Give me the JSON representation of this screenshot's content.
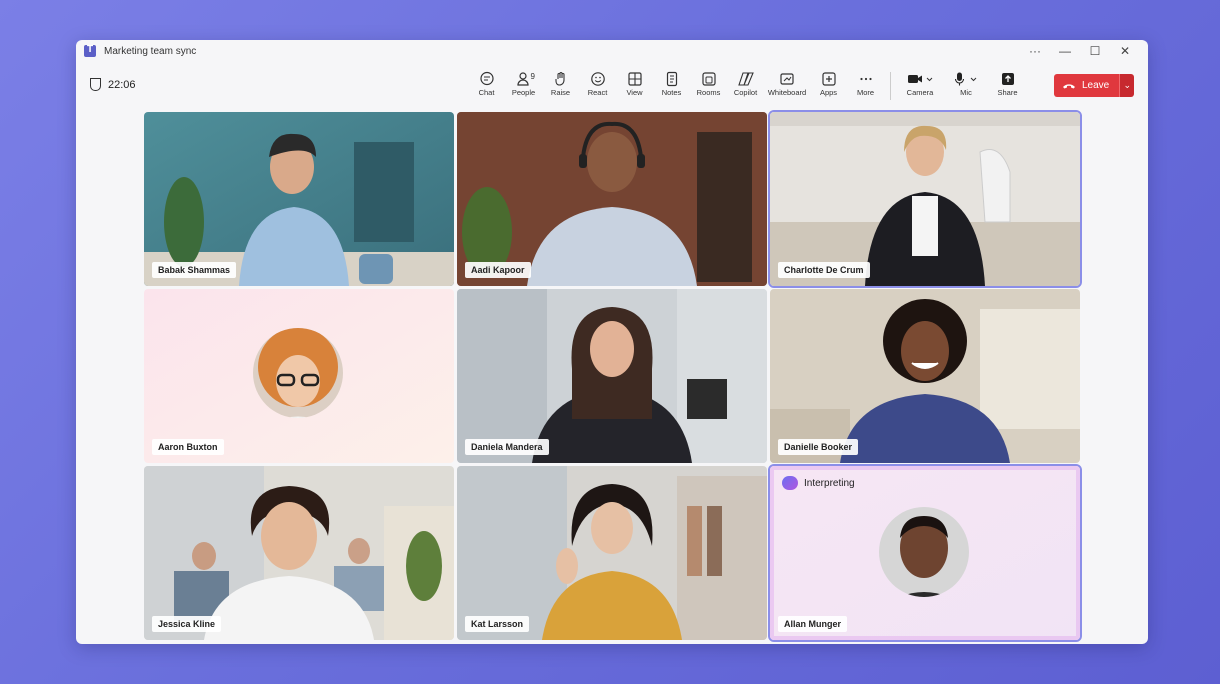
{
  "window": {
    "title": "Marketing team sync",
    "controls": [
      "···",
      "—",
      "☐",
      "✕"
    ]
  },
  "timer": "22:06",
  "toolbar": {
    "items": [
      {
        "label": "Chat",
        "icon": "chat-icon"
      },
      {
        "label": "People",
        "icon": "people-icon",
        "count": "9"
      },
      {
        "label": "Raise",
        "icon": "hand-icon"
      },
      {
        "label": "React",
        "icon": "smile-icon"
      },
      {
        "label": "View",
        "icon": "grid-icon"
      },
      {
        "label": "Notes",
        "icon": "notes-icon"
      },
      {
        "label": "Rooms",
        "icon": "rooms-icon"
      },
      {
        "label": "Copilot",
        "icon": "copilot-icon"
      },
      {
        "label": "Whiteboard",
        "icon": "whiteboard-icon"
      },
      {
        "label": "Apps",
        "icon": "plus-icon"
      },
      {
        "label": "More",
        "icon": "more-icon"
      }
    ],
    "media": [
      {
        "label": "Camera",
        "icon": "camera-icon"
      },
      {
        "label": "Mic",
        "icon": "mic-icon"
      }
    ],
    "share_label": "Share",
    "leave_label": "Leave"
  },
  "participants": [
    {
      "name": "Babak Shammas"
    },
    {
      "name": "Aadi Kapoor"
    },
    {
      "name": "Charlotte De Crum"
    },
    {
      "name": "Aaron Buxton"
    },
    {
      "name": "Daniela Mandera"
    },
    {
      "name": "Danielle Booker"
    },
    {
      "name": "Jessica Kline"
    },
    {
      "name": "Kat Larsson"
    },
    {
      "name": "Allan Munger"
    }
  ],
  "interpreting_label": "Interpreting"
}
